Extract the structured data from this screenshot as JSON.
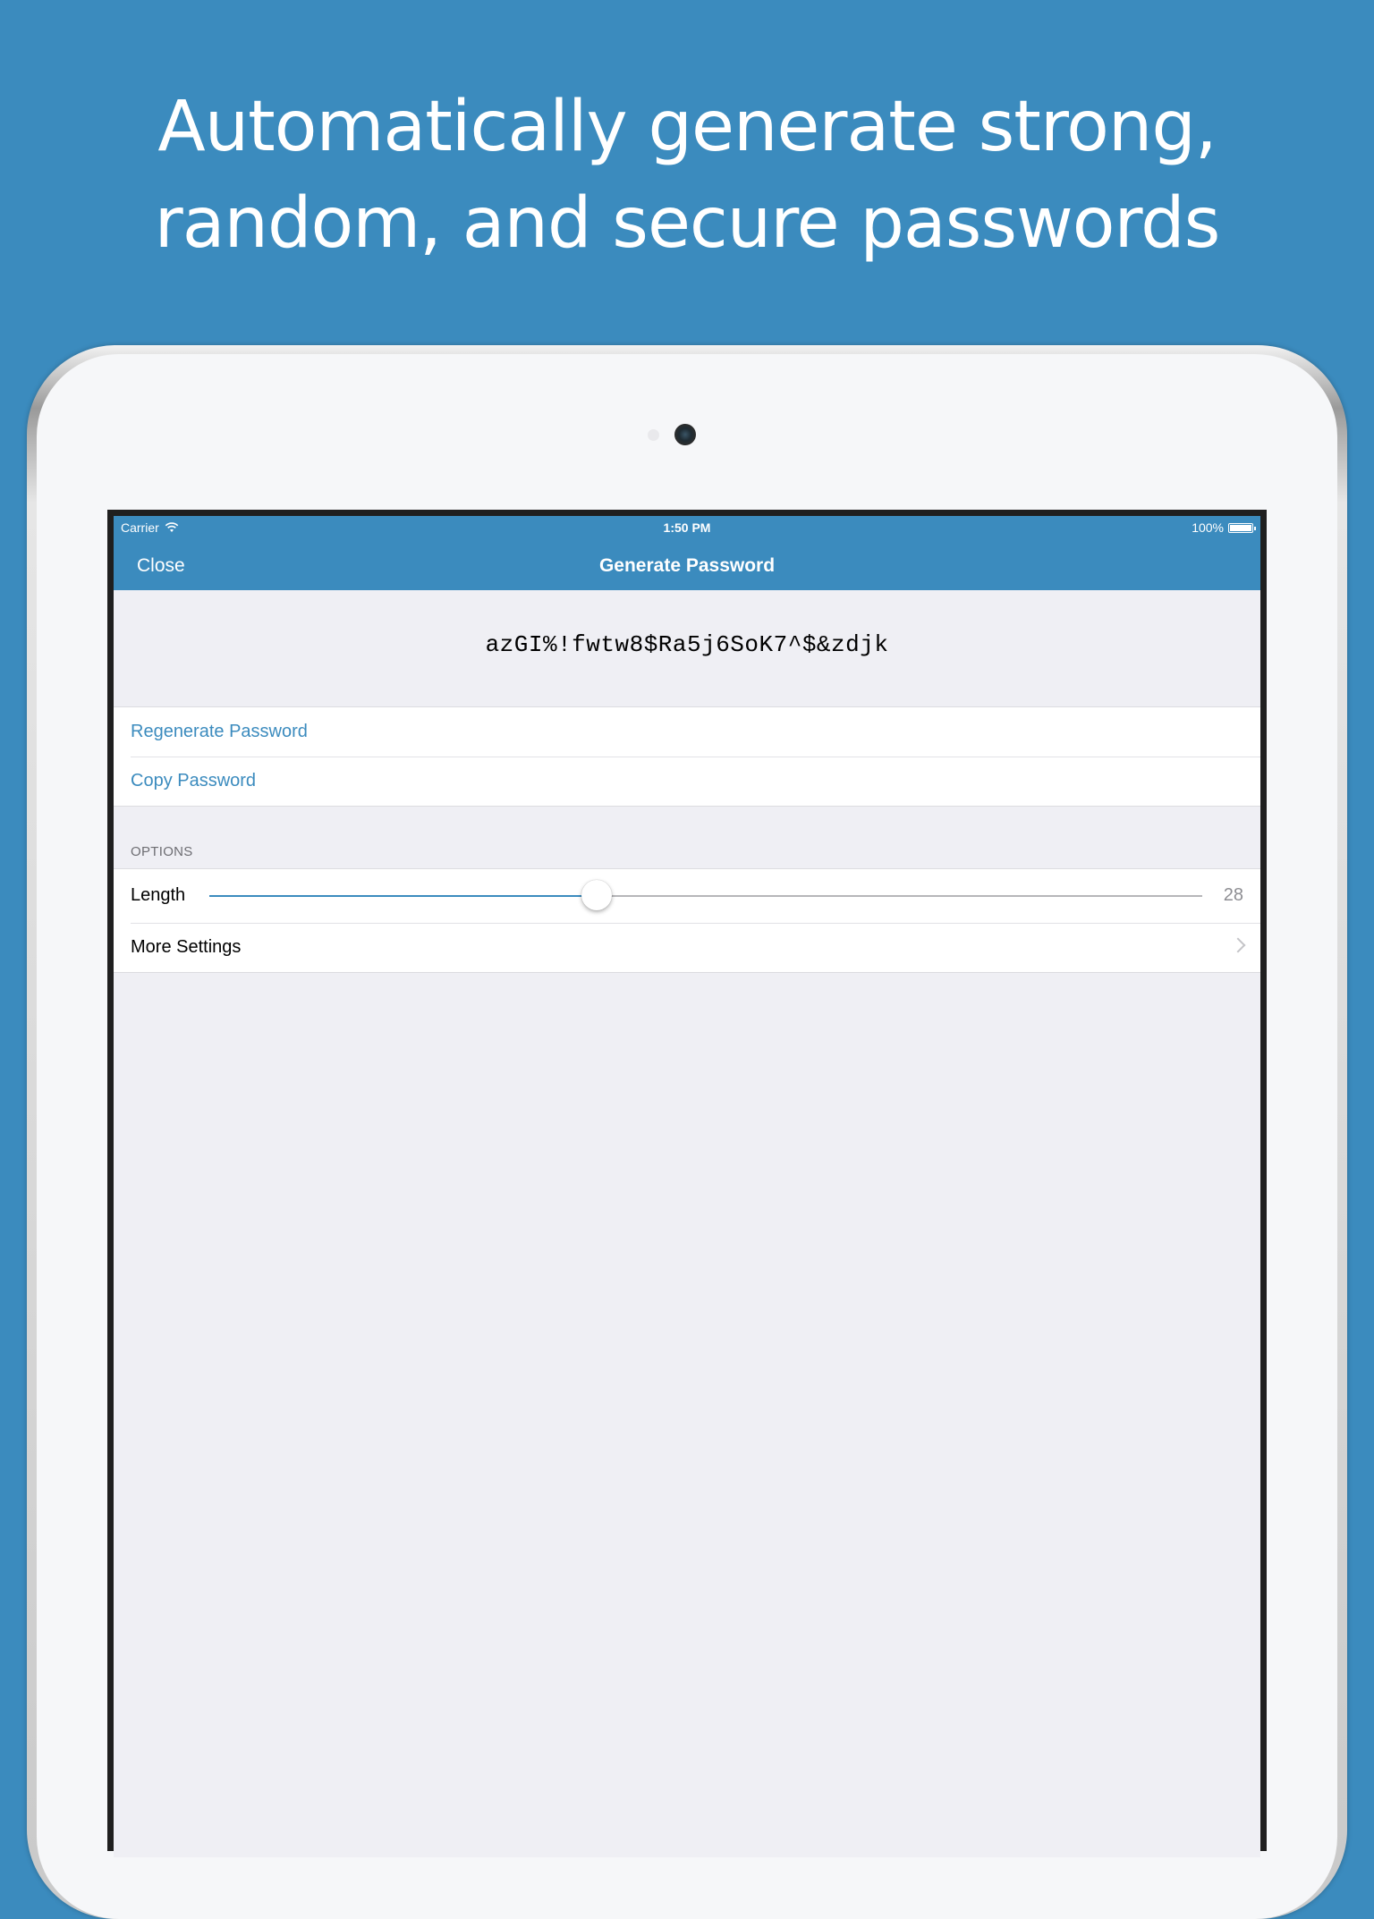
{
  "headline": {
    "line1": "Automatically generate strong,",
    "line2": "random, and secure passwords"
  },
  "status_bar": {
    "carrier": "Carrier",
    "time": "1:50 PM",
    "battery": "100%"
  },
  "nav": {
    "close_label": "Close",
    "title": "Generate Password"
  },
  "password": "azGI%!fwtw8$Ra5j6SoK7^$&zdjk",
  "actions": {
    "regenerate_label": "Regenerate Password",
    "copy_label": "Copy Password"
  },
  "options": {
    "header": "OPTIONS",
    "length_label": "Length",
    "length_value": "28",
    "length_fraction": 0.39,
    "more_settings_label": "More Settings"
  },
  "colors": {
    "accent": "#3b8bbe",
    "background": "#efeff4"
  },
  "icons": {
    "wifi": "wifi-icon",
    "battery": "battery-icon",
    "chevron": "chevron-right-icon"
  }
}
